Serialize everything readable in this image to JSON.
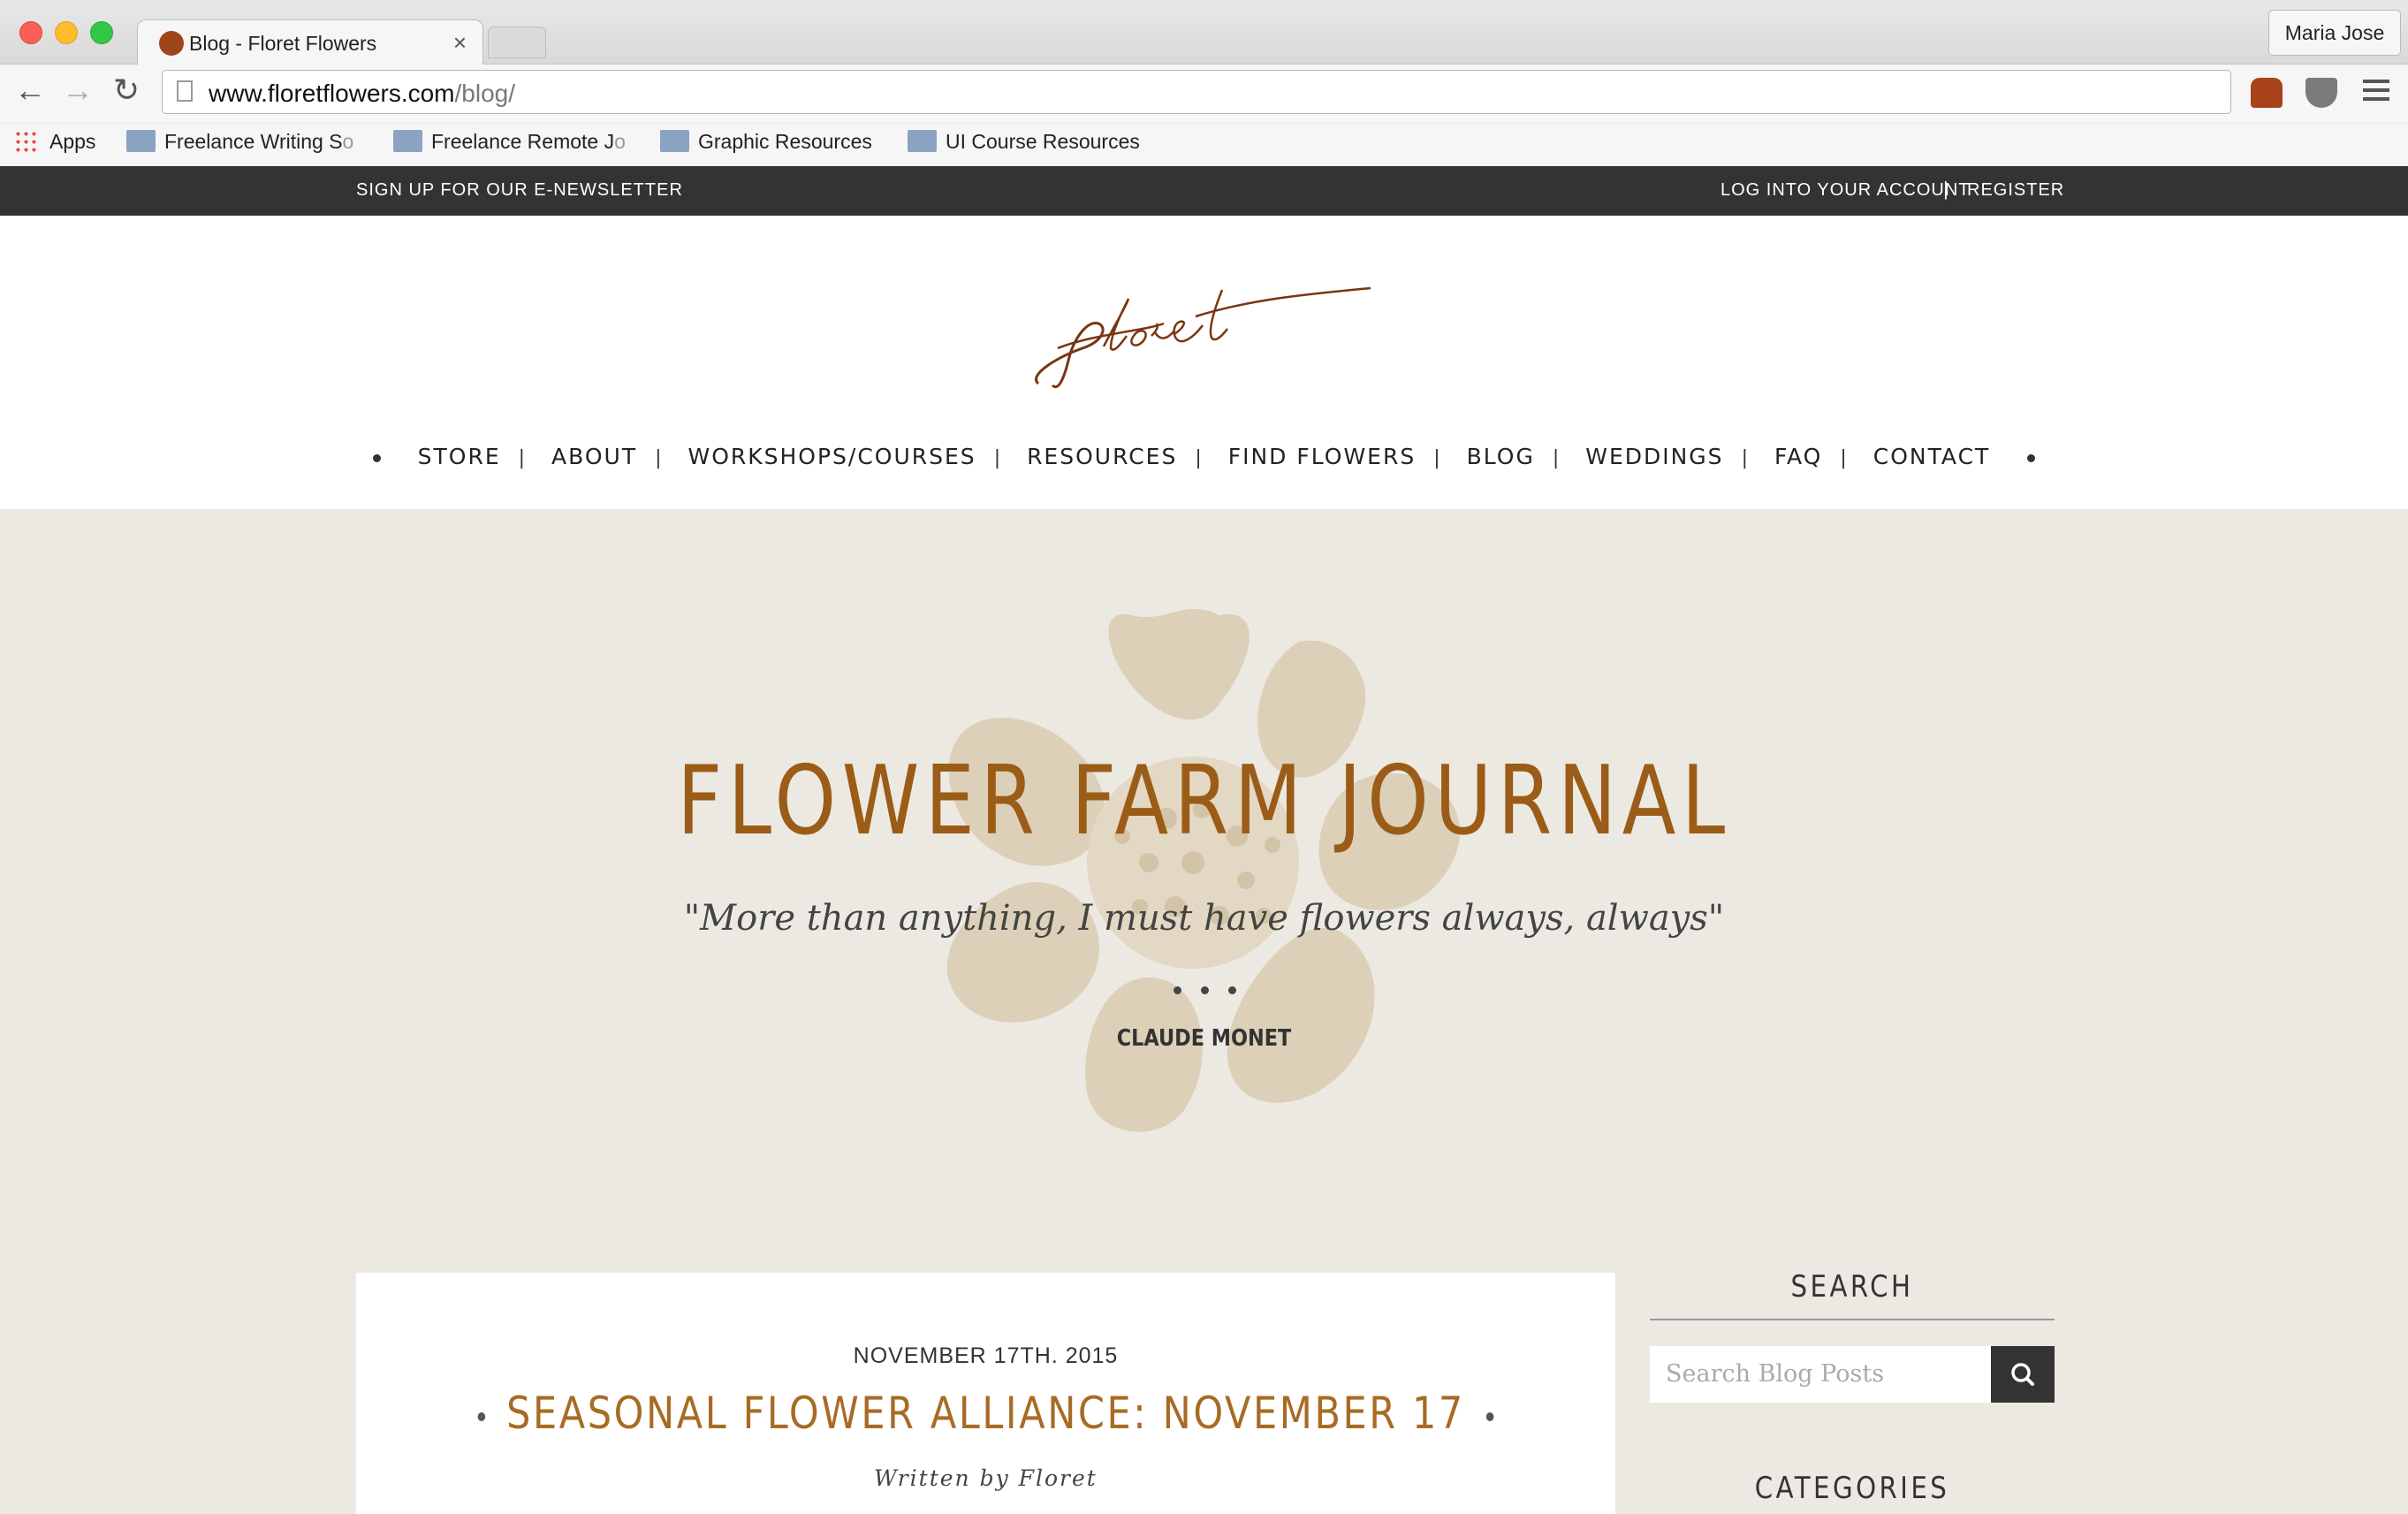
{
  "browser": {
    "tab_title": "Blog - Floret Flowers",
    "tab_close": "×",
    "profile_name": "Maria Jose",
    "url_domain": "www.floretflowers.com",
    "url_path": "/blog/",
    "bookmarks": {
      "apps": "Apps",
      "b1_main": "Freelance Writing S",
      "b1_fade": "o",
      "b2_main": "Freelance Remote J",
      "b2_fade": "o",
      "b3": "Graphic Resources",
      "b4": "UI Course Resources"
    }
  },
  "site": {
    "topbar": {
      "newsletter": "SIGN UP FOR OUR E-NEWSLETTER",
      "login": "LOG INTO YOUR ACCOUNT",
      "separator": "|",
      "register": "REGISTER"
    },
    "logo_text": "floret",
    "nav": [
      "STORE",
      "ABOUT",
      "WORKSHOPS/COURSES",
      "RESOURCES",
      "FIND FLOWERS",
      "BLOG",
      "WEDDINGS",
      "FAQ",
      "CONTACT"
    ],
    "nav_separator": "|",
    "hero": {
      "title": "FLOWER FARM JOURNAL",
      "quote": "\"More than anything, I must have flowers always, always\"",
      "author": "CLAUDE MONET"
    },
    "post": {
      "date": "NOVEMBER 17TH. 2015",
      "title": "SEASONAL FLOWER ALLIANCE: NOVEMBER 17",
      "author": "Written by Floret"
    },
    "sidebar": {
      "search_heading": "SEARCH",
      "search_placeholder": "Search Blog Posts",
      "categories_heading": "CATEGORIES"
    }
  },
  "colors": {
    "accent": "#9a5c17",
    "post_title": "#a86b24",
    "hero_bg": "#ece9e2",
    "topbar_bg": "#333333"
  },
  "icons": [
    "back-icon",
    "forward-icon",
    "reload-icon",
    "page-icon",
    "extension-chair-icon",
    "pocket-icon",
    "menu-icon",
    "apps-icon",
    "folder-icon",
    "search-icon",
    "flower-watermark"
  ]
}
